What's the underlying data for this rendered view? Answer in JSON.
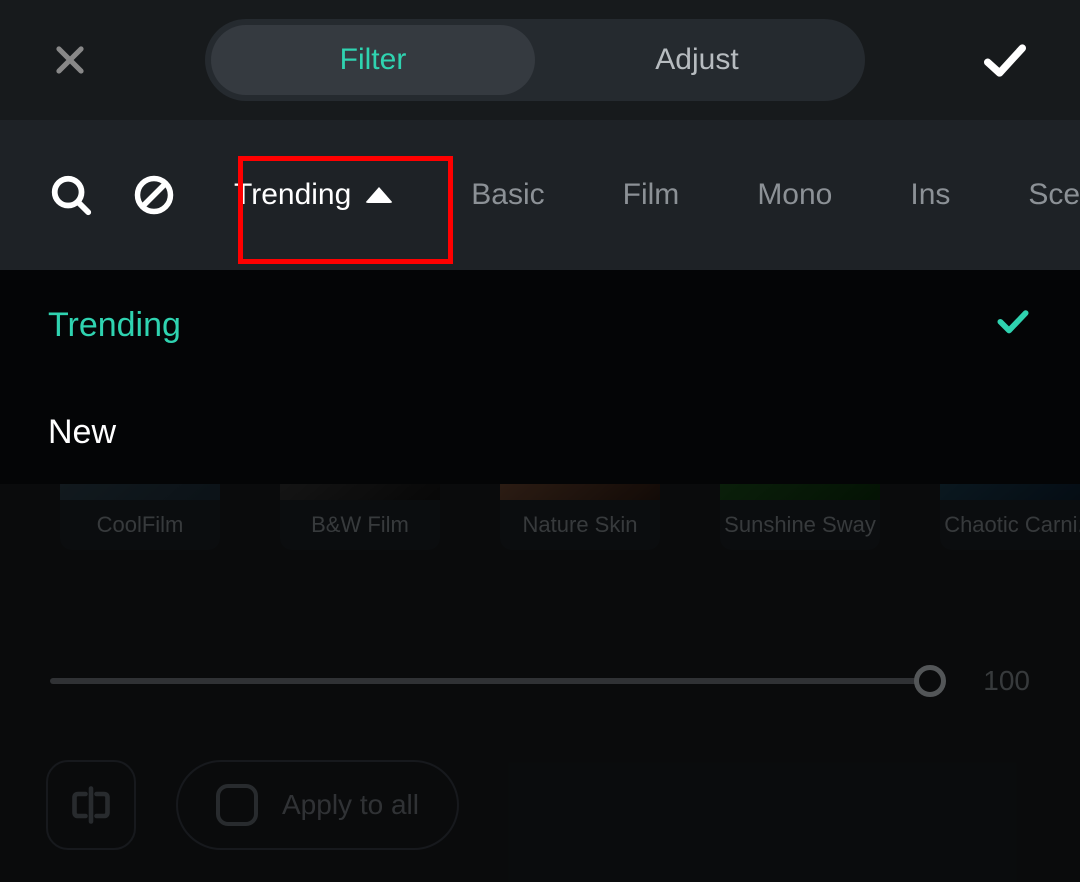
{
  "topTabs": {
    "filter": "Filter",
    "adjust": "Adjust"
  },
  "categories": {
    "trending": "Trending",
    "basic": "Basic",
    "film": "Film",
    "mono": "Mono",
    "ins": "Ins",
    "scenery": "Scenery"
  },
  "dropdown": {
    "trending": "Trending",
    "new": "New"
  },
  "presets": {
    "coolfilm": "CoolFilm",
    "bwfilm": "B&W Film",
    "natureskin": "Nature Skin",
    "sunshinesway": "Sunshine Sway",
    "chaoticcarni": "Chaotic Carni..."
  },
  "slider": {
    "value": "100"
  },
  "actions": {
    "applyAll": "Apply to all"
  }
}
